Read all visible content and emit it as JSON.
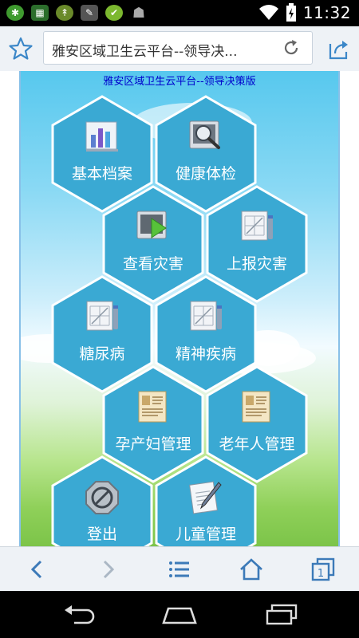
{
  "status_bar": {
    "time": "11:32",
    "left_icons": [
      "android-app-icon",
      "battery-app-icon",
      "game-app-icon",
      "tools-app-icon",
      "sync-app-icon",
      "android-robot-icon"
    ],
    "right_icons": [
      "wifi-icon",
      "charging-battery-icon"
    ]
  },
  "browser": {
    "url_text": "雅安区域卫生云平台--领导决..."
  },
  "page": {
    "title": "雅安区域卫生云平台--领导决策版"
  },
  "tiles": [
    {
      "label": "基本档案",
      "icon": "chart-document-icon"
    },
    {
      "label": "健康体检",
      "icon": "magnifier-icon"
    },
    {
      "label": "查看灾害",
      "icon": "view-disaster-icon"
    },
    {
      "label": "上报灾害",
      "icon": "report-form-icon"
    },
    {
      "label": "糖尿病",
      "icon": "report-form-icon"
    },
    {
      "label": "精神疾病",
      "icon": "report-form-icon"
    },
    {
      "label": "孕产妇管理",
      "icon": "record-card-icon"
    },
    {
      "label": "老年人管理",
      "icon": "record-card-icon"
    },
    {
      "label": "登出",
      "icon": "logout-icon"
    },
    {
      "label": "儿童管理",
      "icon": "pen-document-icon"
    }
  ],
  "browser_nav": [
    "back-icon",
    "forward-icon",
    "menu-icon",
    "home-icon",
    "tabs-icon"
  ],
  "tabs_count": "1",
  "colors": {
    "hex_fill": "#3aa9d3",
    "hex_stroke": "#ffffff",
    "title_text": "#0000cc"
  }
}
